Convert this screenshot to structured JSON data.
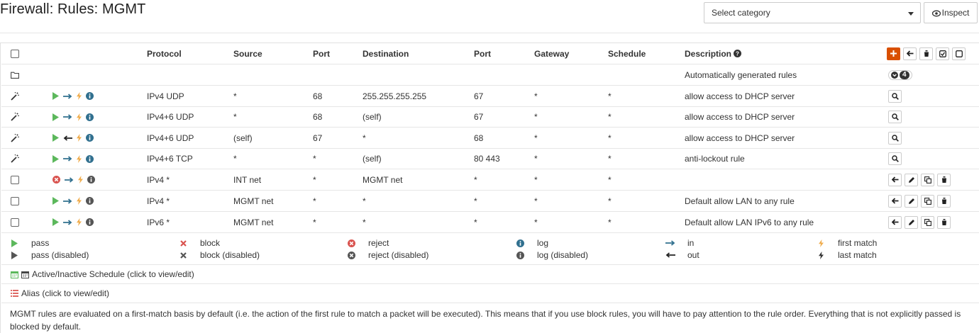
{
  "page": {
    "title": "Firewall: Rules: MGMT",
    "category_select": "Select category",
    "inspect_label": "Inspect"
  },
  "table": {
    "headers": {
      "protocol": "Protocol",
      "source": "Source",
      "port": "Port",
      "destination": "Destination",
      "dport": "Port",
      "gateway": "Gateway",
      "schedule": "Schedule",
      "description": "Description"
    },
    "auto_group": {
      "label": "Automatically generated rules",
      "count": "4"
    },
    "rows": [
      {
        "protocol": "IPv4 UDP",
        "source": "*",
        "port": "68",
        "destination": "255.255.255.255",
        "dport": "67",
        "gateway": "*",
        "schedule": "*",
        "description": "allow access to DHCP server"
      },
      {
        "protocol": "IPv4+6 UDP",
        "source": "*",
        "port": "68",
        "destination": "(self)",
        "dport": "67",
        "gateway": "*",
        "schedule": "*",
        "description": "allow access to DHCP server"
      },
      {
        "protocol": "IPv4+6 UDP",
        "source": "(self)",
        "port": "67",
        "destination": "*",
        "dport": "68",
        "gateway": "*",
        "schedule": "*",
        "description": "allow access to DHCP server"
      },
      {
        "protocol": "IPv4+6 TCP",
        "source": "*",
        "port": "*",
        "destination": "(self)",
        "dport": "80 443",
        "gateway": "*",
        "schedule": "*",
        "description": "anti-lockout rule"
      },
      {
        "protocol": "IPv4 *",
        "source": "INT net",
        "port": "*",
        "destination": "MGMT net",
        "dport": "*",
        "gateway": "*",
        "schedule": "*",
        "description": ""
      },
      {
        "protocol": "IPv4 *",
        "source": "MGMT net",
        "port": "*",
        "destination": "*",
        "dport": "*",
        "gateway": "*",
        "schedule": "*",
        "description": "Default allow LAN to any rule"
      },
      {
        "protocol": "IPv6 *",
        "source": "MGMT net",
        "port": "*",
        "destination": "*",
        "dport": "*",
        "gateway": "*",
        "schedule": "*",
        "description": "Default allow LAN IPv6 to any rule"
      }
    ]
  },
  "legend": {
    "pass": "pass",
    "pass_disabled": "pass (disabled)",
    "block": "block",
    "block_disabled": "block (disabled)",
    "reject": "reject",
    "reject_disabled": "reject (disabled)",
    "log": "log",
    "log_disabled": "log (disabled)",
    "in": "in",
    "out": "out",
    "first_match": "first match",
    "last_match": "last match",
    "schedule": "Active/Inactive Schedule (click to view/edit)",
    "alias": "Alias (click to view/edit)"
  },
  "footer": {
    "text": "MGMT rules are evaluated on a first-match basis by default (i.e. the action of the first rule to match a packet will be executed). This means that if you use block rules, you will have to pay attention to the rule order. Everything that is not explicitly passed is blocked by default."
  },
  "colors": {
    "pass": "#5cb85c",
    "reject": "#d9534f",
    "info": "#31708f",
    "lightning": "#f0ad4e",
    "add_button": "#d94f00"
  }
}
